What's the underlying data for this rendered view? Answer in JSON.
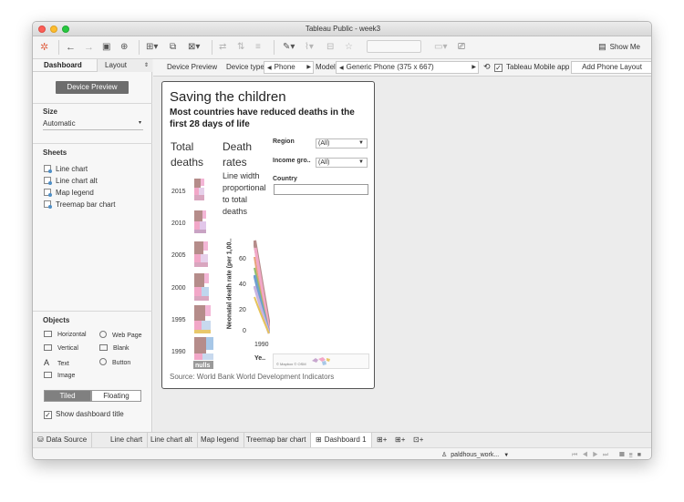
{
  "window": {
    "title": "Tableau Public - week3"
  },
  "toolbar": {
    "show_me_label": "Show Me",
    "icons": [
      "tableau-logo-icon",
      "undo-icon",
      "redo-icon",
      "save-icon",
      "new-datasource-icon",
      "new-worksheet-icon",
      "duplicate-icon",
      "clear-icon",
      "swap-icon",
      "sort-asc-icon",
      "sort-desc-icon",
      "highlight-icon",
      "group-icon",
      "label-icon",
      "fix-axes-icon",
      "fit-icon",
      "presentation-icon",
      "show-me-icon"
    ]
  },
  "sidebar": {
    "tabs": [
      "Dashboard",
      "Layout"
    ],
    "device_preview_button": "Device Preview",
    "size": {
      "title": "Size",
      "value": "Automatic"
    },
    "sheets": {
      "title": "Sheets",
      "items": [
        "Line chart",
        "Line chart alt",
        "Map legend",
        "Treemap bar chart"
      ]
    },
    "objects": {
      "title": "Objects",
      "items": [
        "Horizontal",
        "Web Page",
        "Vertical",
        "Blank",
        "Text",
        "Button",
        "Image"
      ]
    },
    "layout_mode": [
      "Tiled",
      "Floating"
    ],
    "show_title_label": "Show dashboard title"
  },
  "device_bar": {
    "device_preview_label": "Device Preview",
    "device_type_label": "Device type",
    "device_type_value": "Phone",
    "model_label": "Model",
    "model_value": "Generic Phone (375 x 667)",
    "app_label": "Tableau Mobile app",
    "add_layout_button": "Add Phone Layout"
  },
  "dashboard": {
    "title": "Saving the children",
    "subtitle": "Most countries have reduced deaths in the first 28 days of life",
    "total_deaths_title": "Total deaths",
    "death_rates_title": "Death rates",
    "line_width_note": "Line width proportional to total deaths",
    "years": [
      "2015",
      "2010",
      "2005",
      "2000",
      "1995",
      "1990"
    ],
    "y_axis_label": "Neonatal death rate (per 1,00..",
    "y_ticks": [
      "60",
      "40",
      "20",
      "0"
    ],
    "x_tick": "1990",
    "x_axis_label": "Ye..",
    "nulls_label": "nulls",
    "filters": {
      "region_label": "Region",
      "region_value": "(All)",
      "income_label": "Income gro..",
      "income_value": "(All)",
      "country_label": "Country"
    },
    "map_credit": "© Mapbox © OSM",
    "source": "Source: World Bank World Development Indicators"
  },
  "bottom_tabs": {
    "data_source": "Data Source",
    "sheets": [
      "Line chart",
      "Line chart alt",
      "Map legend",
      "Treemap bar chart"
    ],
    "active": "Dashboard 1"
  },
  "status": {
    "user": "paldhous_work..."
  }
}
